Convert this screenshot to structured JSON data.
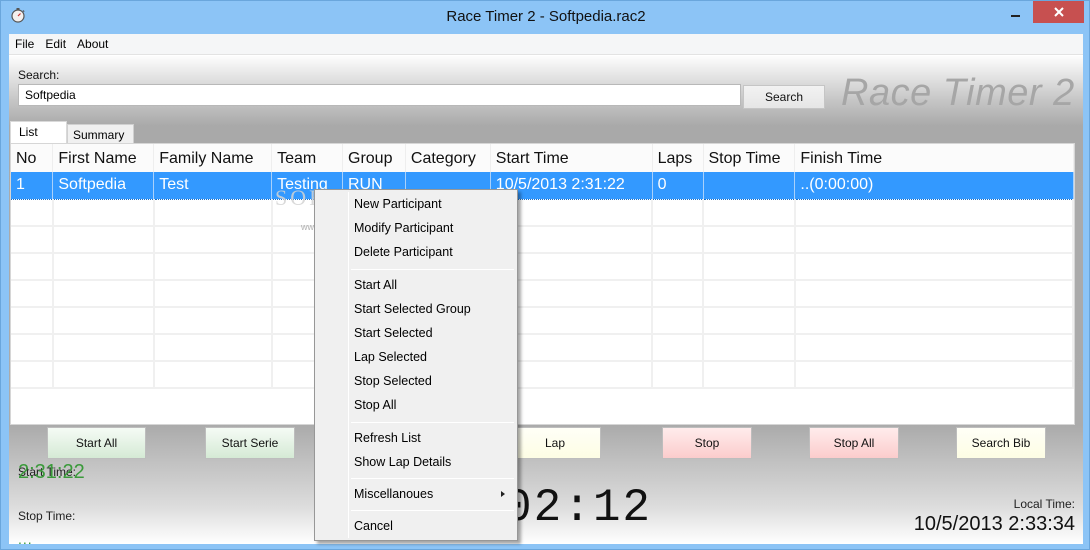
{
  "window": {
    "title": "Race Timer 2 - Softpedia.rac2",
    "icon": "stopwatch-icon",
    "controls": [
      "minimize-icon",
      "maximize-icon",
      "close-icon"
    ]
  },
  "menubar": {
    "items": [
      "File",
      "Edit",
      "About"
    ]
  },
  "search": {
    "label": "Search:",
    "value": "Softpedia",
    "placeholder": "",
    "button_label": "Search"
  },
  "brand": "Race Timer 2",
  "tabs": [
    {
      "label": "List",
      "active": true
    },
    {
      "label": "Summary",
      "active": false
    }
  ],
  "table": {
    "columns": [
      "No",
      "First Name",
      "Family Name",
      "Team",
      "Group",
      "Category",
      "Start Time",
      "Laps",
      "Stop Time",
      "Finish Time"
    ],
    "rows": [
      {
        "selected": true,
        "cells": [
          "1",
          "Softpedia",
          "Test",
          "Testing",
          "RUN",
          "",
          "10/5/2013 2:31:22",
          "0",
          "",
          "..(0:00:00)"
        ]
      }
    ],
    "empty_rows": 7
  },
  "buttons": {
    "start_all": "Start All",
    "start_serie": "Start Serie",
    "lap": "Lap",
    "stop": "Stop",
    "stop_all": "Stop All",
    "search_bib": "Search Bib"
  },
  "status": {
    "start_time_label": "Start Time:",
    "start_time_value": "2:31:22",
    "stop_time_label": "Stop Time:",
    "stop_time_value": "...",
    "elapsed_visible": "02:12",
    "local_time_label": "Local Time:",
    "local_time_value": "10/5/2013 2:33:34"
  },
  "context_menu": {
    "groups": [
      [
        "New Participant",
        "Modify Participant",
        "Delete Participant"
      ],
      [
        "Start All",
        "Start Selected Group",
        "Start Selected",
        "Lap Selected",
        "Stop Selected",
        "Stop All"
      ],
      [
        "Refresh List",
        "Show Lap Details"
      ],
      [
        "Miscellanoues"
      ],
      [
        "Cancel"
      ]
    ],
    "submenu_items": [
      "Miscellanoues"
    ]
  },
  "watermark": {
    "text": "SOFTPEDIA",
    "url": "www.softpedia.com"
  },
  "colors": {
    "titlebar": "#8cc4f6",
    "close_button": "#c75050",
    "selection": "#3399ff",
    "start_time_green": "#3a9a3a",
    "brand_gray": "#a6a6a6"
  }
}
